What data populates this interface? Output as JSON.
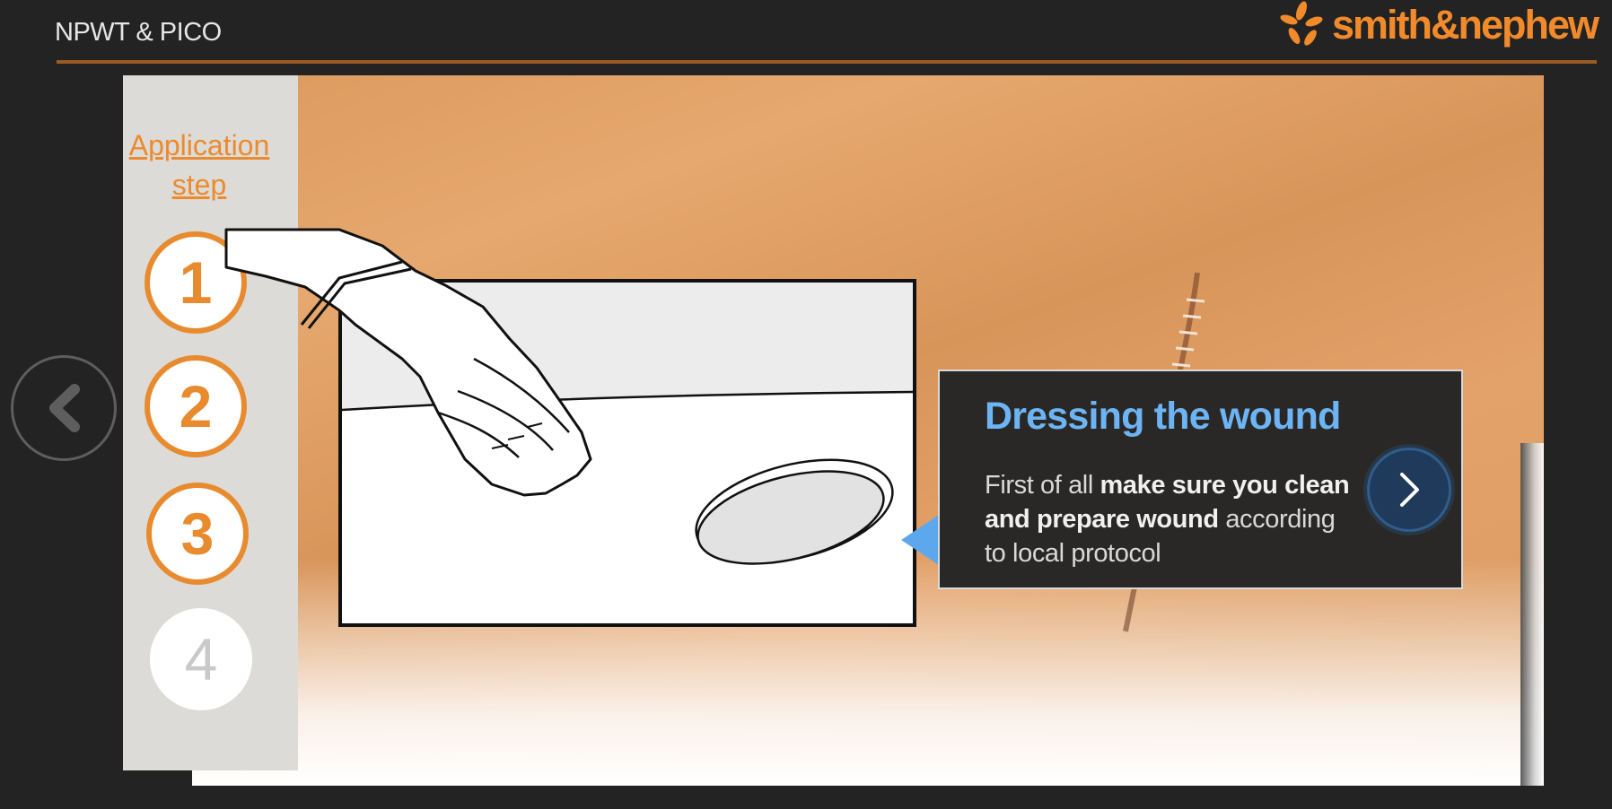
{
  "header": {
    "title": "NPWT & PICO",
    "brand": "smith&nephew"
  },
  "sidebar": {
    "heading_line1": "Application",
    "heading_line2": "step",
    "steps": [
      {
        "label": "1",
        "state": "completed"
      },
      {
        "label": "2",
        "state": "completed"
      },
      {
        "label": "3",
        "state": "completed"
      },
      {
        "label": "4",
        "state": "inactive"
      }
    ]
  },
  "info_card": {
    "title": "Dressing the wound",
    "body_prefix": "First of all ",
    "body_bold": "make sure you clean and prepare wound",
    "body_suffix": " according to local protocol"
  },
  "icons": {
    "back": "chevron-left-icon",
    "next": "chevron-right-icon",
    "logo": "starburst-logo-icon"
  },
  "colors": {
    "accent": "#e88a2e",
    "title_blue": "#6cb4f4",
    "background": "#232323"
  }
}
